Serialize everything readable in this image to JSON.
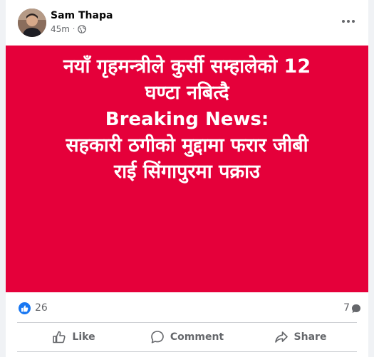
{
  "post": {
    "author": "Sam Thapa",
    "time": "45m",
    "separator": "·",
    "privacy_icon": "globe-icon",
    "more_icon": "more-horizontal-icon"
  },
  "image": {
    "background_color": "#e5003a",
    "lines": [
      "नयाँ गृहमन्त्रीले कुर्सी सम्हालेको 12",
      "घण्टा नबित्दै",
      "Breaking News:",
      "सहकारी ठगीको मुद्दामा फरार जीबी",
      "राई सिंगापुरमा पक्राउ"
    ]
  },
  "stats": {
    "reactions": "26",
    "comments": "7",
    "reaction_icon": "like-reaction-icon",
    "comment_icon": "comment-bubble-icon"
  },
  "actions": {
    "like": "Like",
    "comment": "Comment",
    "share": "Share"
  },
  "colors": {
    "accent": "#1877f2",
    "muted_text": "#65676b"
  }
}
